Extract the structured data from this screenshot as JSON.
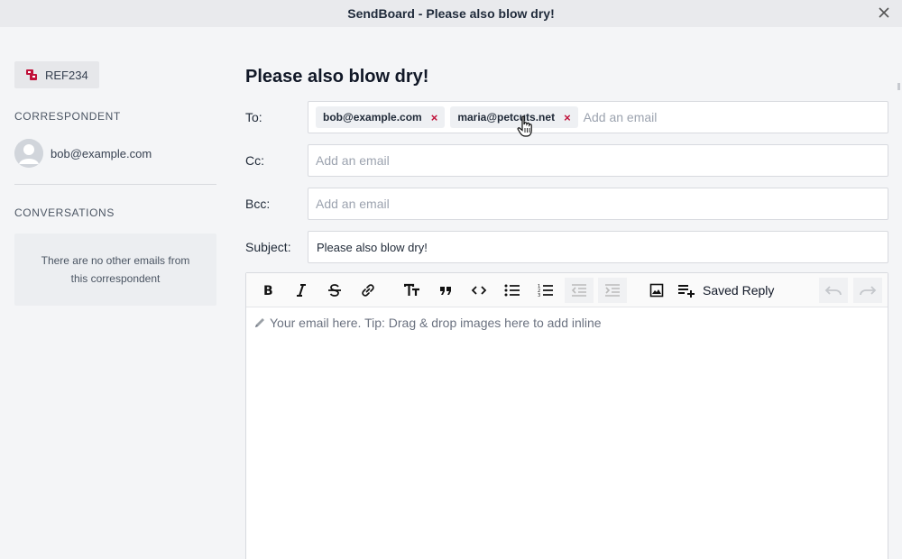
{
  "window": {
    "title": "SendBoard - Please also blow dry!"
  },
  "sidebar": {
    "ref_label": "REF234",
    "correspondent_heading": "CORRESPONDENT",
    "correspondent_email": "bob@example.com",
    "conversations_heading": "CONVERSATIONS",
    "no_conversations_text": "There are no other emails from this correspondent"
  },
  "email": {
    "title": "Please also blow dry!",
    "to": {
      "label": "To:",
      "chips": [
        "bob@example.com",
        "maria@petcuts.net"
      ],
      "placeholder": "Add an email"
    },
    "cc": {
      "label": "Cc:",
      "placeholder": "Add an email"
    },
    "bcc": {
      "label": "Bcc:",
      "placeholder": "Add an email"
    },
    "subject": {
      "label": "Subject:",
      "value": "Please also blow dry!"
    },
    "chip_remove": "×"
  },
  "editor": {
    "saved_reply_label": "Saved Reply",
    "placeholder": "Your email here. Tip: Drag & drop images here to add inline"
  },
  "colors": {
    "accent": "#c0113a",
    "chip_bg": "#eef0f3"
  }
}
